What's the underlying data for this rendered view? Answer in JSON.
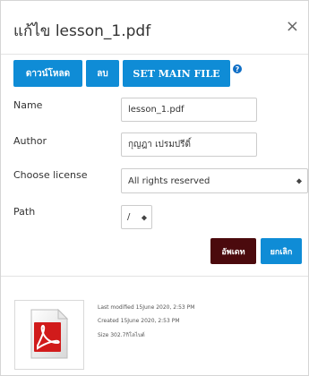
{
  "dialog": {
    "title": "แก้ไข lesson_1.pdf",
    "close_symbol": "×"
  },
  "toolbar": {
    "download_label": "ดาวน์โหลด",
    "delete_label": "ลบ",
    "set_main_label": "SET MAIN FILE",
    "help_symbol": "?"
  },
  "form": {
    "name_label": "Name",
    "name_value": "lesson_1.pdf",
    "author_label": "Author",
    "author_value": "กุญฎา เปรมปรีดิ์",
    "license_label": "Choose license",
    "license_value": "All rights reserved",
    "path_label": "Path",
    "path_value": "/",
    "update_label": "อัพเดท",
    "cancel_label": "ยกเลิก"
  },
  "file_info": {
    "last_modified": "Last modified 15June 2020, 2:53 PM",
    "created": "Created 15June 2020, 2:53 PM",
    "size": "Size 302.7กิโลไบต์",
    "icon": "pdf-file-icon"
  },
  "colors": {
    "primary": "#0f8cd6",
    "update": "#4b0a0d",
    "pdf_red": "#d11b1b"
  }
}
